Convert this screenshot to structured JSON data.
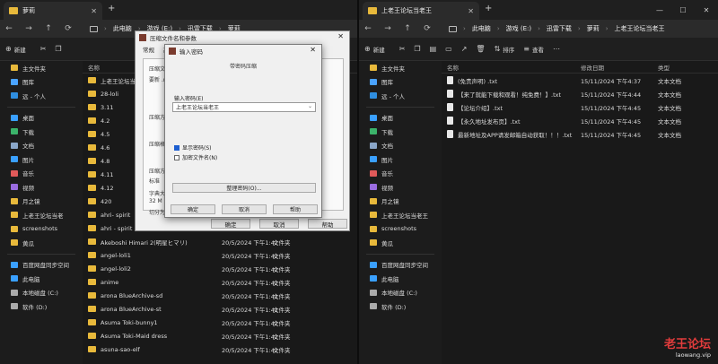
{
  "left": {
    "tab_title": "萝莉",
    "breadcrumbs": [
      "此电脑",
      "游戏 (E:)",
      "迅雷下载",
      "萝莉"
    ],
    "toolbar": {
      "new_label": "新建"
    },
    "columns": {
      "name": "名称"
    },
    "sidebar": [
      {
        "label": "主文件夹",
        "color": "#e8b93b"
      },
      {
        "label": "图库",
        "color": "#4aa3ff"
      },
      {
        "label": "远 - 个人",
        "color": "#2f8ee0"
      },
      {
        "label": "",
        "color": ""
      },
      {
        "label": "桌面",
        "color": "#3aa0ff"
      },
      {
        "label": "下载",
        "color": "#3bb36a"
      },
      {
        "label": "文档",
        "color": "#8aa6c8"
      },
      {
        "label": "图片",
        "color": "#3aa0ff"
      },
      {
        "label": "音乐",
        "color": "#e05a5a"
      },
      {
        "label": "视频",
        "color": "#9a6ce0"
      },
      {
        "label": "月之镜",
        "color": "#e8b93b"
      },
      {
        "label": "上老王论坛当老",
        "color": "#e8b93b"
      },
      {
        "label": "screenshots",
        "color": "#e8b93b"
      },
      {
        "label": "黄瓜",
        "color": "#e8b93b"
      },
      {
        "label": "",
        "color": ""
      },
      {
        "label": "百度网盘同步空间",
        "color": "#3aa0ff"
      },
      {
        "label": "此电脑",
        "color": "#3aa0ff"
      },
      {
        "label": "本地磁盘 (C:)",
        "color": "#aaa"
      },
      {
        "label": "软件 (D:)",
        "color": "#aaa"
      }
    ],
    "files": [
      {
        "name": "上老王论坛当老王",
        "date": "",
        "type": ""
      },
      {
        "name": "28-loli",
        "date": "",
        "type": ""
      },
      {
        "name": "3.11",
        "date": "",
        "type": ""
      },
      {
        "name": "4.2",
        "date": "",
        "type": ""
      },
      {
        "name": "4.5",
        "date": "",
        "type": ""
      },
      {
        "name": "4.6",
        "date": "",
        "type": ""
      },
      {
        "name": "4.8",
        "date": "",
        "type": ""
      },
      {
        "name": "4.11",
        "date": "",
        "type": ""
      },
      {
        "name": "4.12",
        "date": "",
        "type": ""
      },
      {
        "name": "420",
        "date": "",
        "type": ""
      },
      {
        "name": "ahri- spirit",
        "date": "",
        "type": ""
      },
      {
        "name": "ahri - spirit 2",
        "date": "",
        "type": ""
      },
      {
        "name": "Akeboshi Himari 2(明星ヒマリ)",
        "date": "20/5/2024 下午1:42",
        "type": "文件夹"
      },
      {
        "name": "angel-loli1",
        "date": "20/5/2024 下午1:42",
        "type": "文件夹"
      },
      {
        "name": "angel-loli2",
        "date": "20/5/2024 下午1:42",
        "type": "文件夹"
      },
      {
        "name": "anime",
        "date": "20/5/2024 下午1:42",
        "type": "文件夹"
      },
      {
        "name": "arona BlueArchive-sd",
        "date": "20/5/2024 下午1:41",
        "type": "文件夹"
      },
      {
        "name": "arona BlueArchive-st",
        "date": "20/5/2024 下午1:41",
        "type": "文件夹"
      },
      {
        "name": "Asuma Toki-bunny1",
        "date": "20/5/2024 下午1:42",
        "type": "文件夹"
      },
      {
        "name": "Asuma Toki-Maid dress",
        "date": "20/5/2024 下午1:42",
        "type": "文件夹"
      },
      {
        "name": "asuna-sao-elf",
        "date": "20/5/2024 下午1:42",
        "type": "文件夹"
      }
    ]
  },
  "right": {
    "tab_title": "上老王论坛当老王",
    "breadcrumbs": [
      "此电脑",
      "游戏 (E:)",
      "迅雷下载",
      "萝莉",
      "上老王论坛当老王"
    ],
    "toolbar": {
      "new_label": "新建",
      "sort_label": "排序",
      "view_label": "查看"
    },
    "columns": {
      "name": "名称",
      "date": "修改日期",
      "type": "类型"
    },
    "sidebar": [
      {
        "label": "主文件夹",
        "color": "#e8b93b"
      },
      {
        "label": "图库",
        "color": "#4aa3ff"
      },
      {
        "label": "远 - 个人",
        "color": "#2f8ee0"
      },
      {
        "label": "",
        "color": ""
      },
      {
        "label": "桌面",
        "color": "#3aa0ff"
      },
      {
        "label": "下载",
        "color": "#3bb36a"
      },
      {
        "label": "文档",
        "color": "#8aa6c8"
      },
      {
        "label": "图片",
        "color": "#3aa0ff"
      },
      {
        "label": "音乐",
        "color": "#e05a5a"
      },
      {
        "label": "视频",
        "color": "#9a6ce0"
      },
      {
        "label": "月之镜",
        "color": "#e8b93b"
      },
      {
        "label": "上老王论坛当老王",
        "color": "#e8b93b"
      },
      {
        "label": "screenshots",
        "color": "#e8b93b"
      },
      {
        "label": "黄瓜",
        "color": "#e8b93b"
      },
      {
        "label": "",
        "color": ""
      },
      {
        "label": "百度网盘同步空间",
        "color": "#3aa0ff"
      },
      {
        "label": "此电脑",
        "color": "#3aa0ff"
      },
      {
        "label": "本地磁盘 (C:)",
        "color": "#aaa"
      },
      {
        "label": "软件 (D:)",
        "color": "#aaa"
      }
    ],
    "files": [
      {
        "name": "(免责声明) .txt",
        "date": "15/11/2024 下午4:37",
        "type": "文本文档"
      },
      {
        "name": "【来了就能下载和观看！纯免费！】.txt",
        "date": "15/11/2024 下午4:44",
        "type": "文本文档"
      },
      {
        "name": "【论坛介绍】.txt",
        "date": "15/11/2024 下午4:45",
        "type": "文本文档"
      },
      {
        "name": "【永久地址发布页】.txt",
        "date": "15/11/2024 下午4:45",
        "type": "文本文档"
      },
      {
        "name": "最新地址及APP请发邮箱自动获取！！！.txt",
        "date": "15/11/2024 下午4:45",
        "type": "文本文档"
      }
    ]
  },
  "dialog_back": {
    "title": "压缩文件名和参数",
    "tabs": [
      "常规",
      "高"
    ],
    "labels": [
      "压缩文",
      "要新 .ra",
      "压缩方",
      "压缩格",
      "压缩方",
      "标准",
      "字典大",
      "32 M",
      "切分为"
    ],
    "ok_label": "确定",
    "cancel_label": "取消",
    "help_label": "帮助"
  },
  "dialog_front": {
    "title": "输入密码",
    "heading": "带密码压缩",
    "password_label": "输入密码(E)",
    "password_value": "上老王论坛当老王",
    "show_password_label": "显示密码(S)",
    "encrypt_names_label": "加密文件名(N)",
    "organize_label": "整理密码(O)...",
    "ok_label": "确定",
    "cancel_label": "取消",
    "help_label": "帮助"
  },
  "watermark": {
    "title": "老王论坛",
    "url": "laowang.vip"
  }
}
